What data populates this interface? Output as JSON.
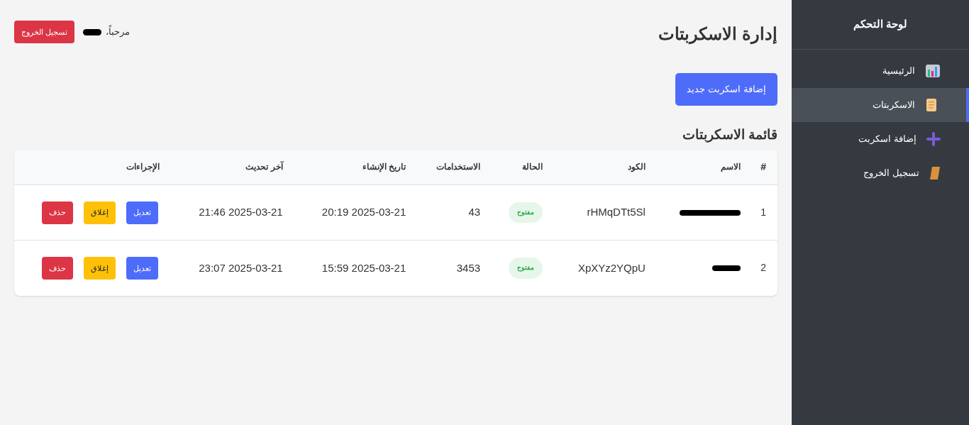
{
  "sidebar": {
    "title": "لوحة التحكم",
    "items": [
      {
        "label": "الرئيسية",
        "selected": false
      },
      {
        "label": "الاسكربتات",
        "selected": true
      },
      {
        "label": "إضافة اسكربت",
        "selected": false
      },
      {
        "label": "تسجيل الخروج",
        "selected": false
      }
    ]
  },
  "header": {
    "title": "إدارة الاسكربتات",
    "greeting": "مرحباً،",
    "logout_button": "تسجيل الخروج"
  },
  "add_button": "إضافة اسكربت جديد",
  "table": {
    "title": "قائمة الاسكربتات",
    "columns": [
      "#",
      "الاسم",
      "الكود",
      "الحالة",
      "الاستخدامات",
      "تاريخ الإنشاء",
      "آخر تحديث",
      "الإجراءات"
    ],
    "rows": [
      {
        "index": "1",
        "code": "rHMqDTt5Sl",
        "status": {
          "label": "مفتوح",
          "kind": "open"
        },
        "uses": "43",
        "created": "2025-03-21 20:19",
        "updated": "2025-03-21 21:46",
        "actions": [
          "تعديل",
          "إغلاق",
          "حذف"
        ]
      },
      {
        "index": "2",
        "code": "XpXYz2YQpU",
        "status": {
          "label": "مفتوح",
          "kind": "open"
        },
        "uses": "3453",
        "created": "2025-03-21 15:59",
        "updated": "2025-03-21 23:07",
        "actions": [
          "تعديل",
          "إغلاق",
          "حذف"
        ]
      }
    ]
  }
}
